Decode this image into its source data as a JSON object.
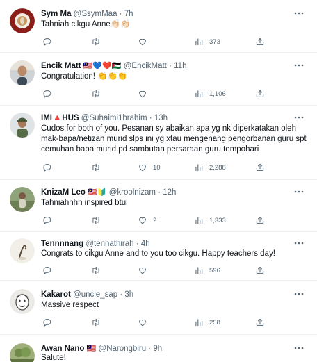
{
  "tweets": [
    {
      "name": "Sym Ma",
      "flags": "",
      "handle": "@SsymMaa",
      "sep": "·",
      "time": "7h",
      "text": "Tahniah cikgu Anne👏🏻👏🏻",
      "replies": "",
      "retweets": "",
      "likes": "",
      "views": "373",
      "avatar": "coffee-avatar"
    },
    {
      "name": "Encik Matt",
      "flags": "🇲🇾💙❤️🇵🇸",
      "handle": "@EncikMatt",
      "sep": "·",
      "time": "11h",
      "text": "Congratulation! 👏👏👏",
      "replies": "",
      "retweets": "",
      "likes": "",
      "views": "1,106",
      "avatar": "man-avatar"
    },
    {
      "name": "IMI🔺HUS",
      "flags": "",
      "handle": "@Suhaimi1brahim",
      "sep": "·",
      "time": "13h",
      "text": "Cudos for both of you. Pesanan sy abaikan apa yg nk diperkatakan oleh mak-bapa/netizan murid slps ini yg xtau mengenang pengorbanan guru spt cemuhan bapa murid pd sambutan persaraan guru tempohari",
      "replies": "",
      "retweets": "",
      "likes": "10",
      "views": "2,288",
      "avatar": "soldier-avatar"
    },
    {
      "name": "KnizaM Leo",
      "flags": "🇲🇾🔰",
      "handle": "@kroolnizam",
      "sep": "·",
      "time": "12h",
      "text": "Tahniahhhh inspired btul",
      "replies": "",
      "retweets": "",
      "likes": "2",
      "views": "1,333",
      "avatar": "outdoor-avatar"
    },
    {
      "name": "Tennnnang",
      "flags": "",
      "handle": "@tennathirah",
      "sep": "·",
      "time": "4h",
      "text": "Congrats to cikgu Anne and to you too cikgu. Happy teachers day!",
      "replies": "",
      "retweets": "",
      "likes": "",
      "views": "596",
      "avatar": "sketch-avatar"
    },
    {
      "name": "Kakarot",
      "flags": "",
      "handle": "@uncle_sap",
      "sep": "·",
      "time": "3h",
      "text": "Massive respect",
      "replies": "",
      "retweets": "",
      "likes": "",
      "views": "258",
      "avatar": "cartoon-avatar"
    },
    {
      "name": "Awan Nano",
      "flags": "🇲🇾",
      "handle": "@Narongbiru",
      "sep": "·",
      "time": "9h",
      "text": "Salute!",
      "replies": "",
      "retweets": "",
      "likes": "",
      "views": "",
      "avatar": "nature-avatar"
    }
  ],
  "colors": {
    "text": "#0f1419",
    "secondary": "#536471",
    "divider": "#eff3f4"
  }
}
